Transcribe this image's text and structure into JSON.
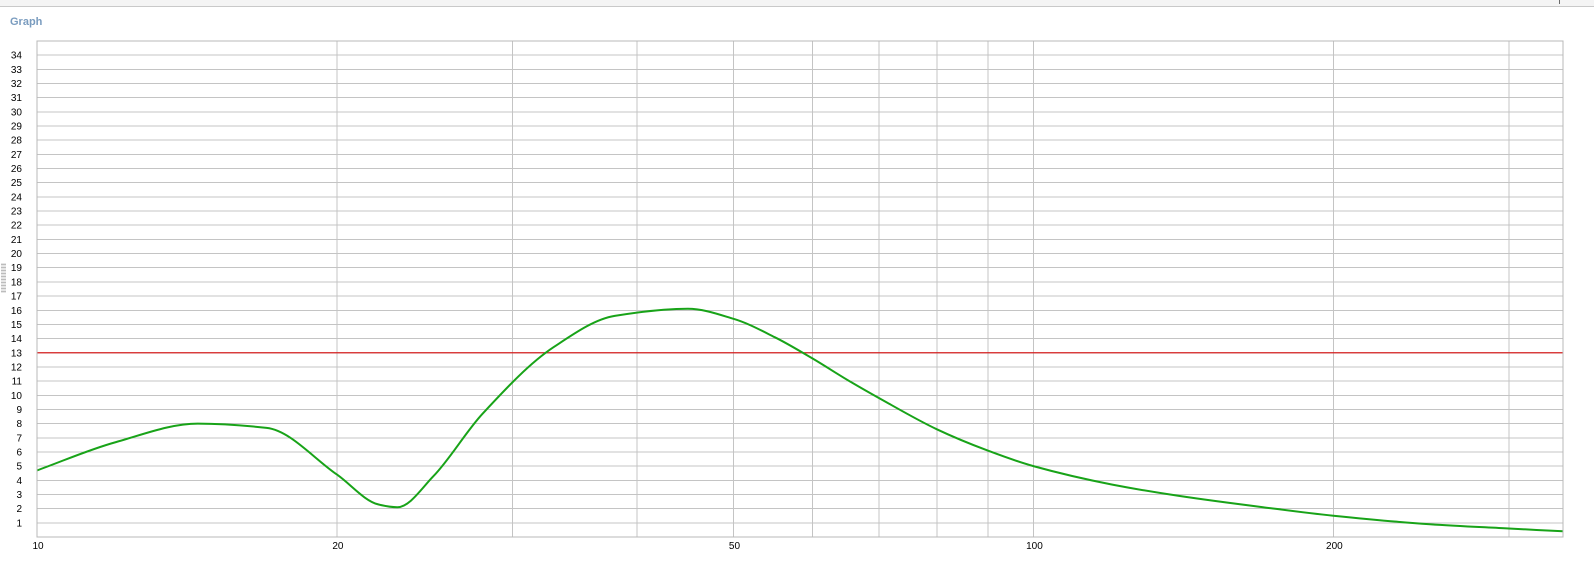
{
  "panel": {
    "title": "Graph"
  },
  "colors": {
    "grid": "#c4c4c4",
    "curve": "#18a318",
    "threshold": "#d42020",
    "title": "#7a9cbf"
  },
  "chart_data": {
    "type": "line",
    "title": "",
    "xlabel": "",
    "ylabel": "",
    "xscale": "log",
    "xlim": [
      10,
      340
    ],
    "ylim": [
      0,
      35
    ],
    "grid": true,
    "x_tick_labels": [
      {
        "value": 10,
        "label": "10"
      },
      {
        "value": 20,
        "label": "20"
      },
      {
        "value": 50,
        "label": "50"
      },
      {
        "value": 100,
        "label": "100"
      },
      {
        "value": 200,
        "label": "200"
      }
    ],
    "x_gridlines": [
      20,
      30,
      40,
      50,
      60,
      70,
      80,
      90,
      100,
      200,
      300
    ],
    "y_ticks": [
      1,
      2,
      3,
      4,
      5,
      6,
      7,
      8,
      9,
      10,
      11,
      12,
      13,
      14,
      15,
      16,
      17,
      18,
      19,
      20,
      21,
      22,
      23,
      24,
      25,
      26,
      27,
      28,
      29,
      30,
      31,
      32,
      33,
      34
    ],
    "series": [
      {
        "color": "#18a318",
        "x": [
          10,
          12,
          14.5,
          17,
          20,
          22,
          23,
          25,
          28,
          33,
          38,
          45,
          50,
          55,
          60,
          65,
          70,
          80,
          90,
          100,
          120,
          140,
          170,
          200,
          250,
          300,
          340
        ],
        "y": [
          4.7,
          6.7,
          8.0,
          7.7,
          4.4,
          2.3,
          2.1,
          4.3,
          8.7,
          13.4,
          15.6,
          16.1,
          15.4,
          14.1,
          12.6,
          11.1,
          9.8,
          7.6,
          6.1,
          5.0,
          3.7,
          2.9,
          2.1,
          1.5,
          0.9,
          0.6,
          0.4
        ]
      }
    ],
    "reference_lines": [
      {
        "axis": "y",
        "value": 13,
        "color": "#d42020"
      }
    ]
  }
}
